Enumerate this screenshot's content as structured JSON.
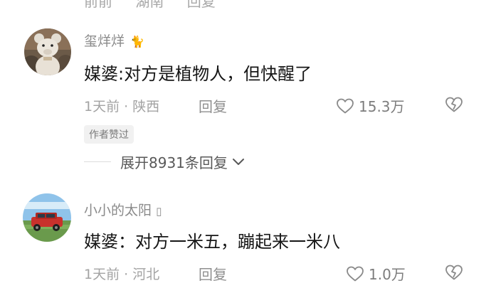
{
  "top_cut_row": {
    "time": "前前",
    "location": "湖南",
    "reply": "回复"
  },
  "comments": [
    {
      "username": "玺烊烊",
      "username_badge": "🐈",
      "content": "媒婆:对方是植物人，但快醒了",
      "time_location": "1天前 · 陕西",
      "reply_label": "回复",
      "like_count": "15.3万",
      "author_liked_tag": "作者赞过",
      "expand_label": "展开8931条回复"
    },
    {
      "username": "小小的太阳",
      "username_badge": "▯",
      "content": "媒婆：对方一米五，蹦起来一米八",
      "time_location": "1天前 · 河北",
      "reply_label": "回复",
      "like_count": "1.0万"
    }
  ],
  "icons": {
    "like": "heart-outline-icon",
    "dislike": "broken-heart-icon",
    "expand": "chevron-down-icon"
  },
  "colors": {
    "text_primary": "#161616",
    "text_meta": "#a3a3a3",
    "tag_bg": "#f1f1f1"
  }
}
